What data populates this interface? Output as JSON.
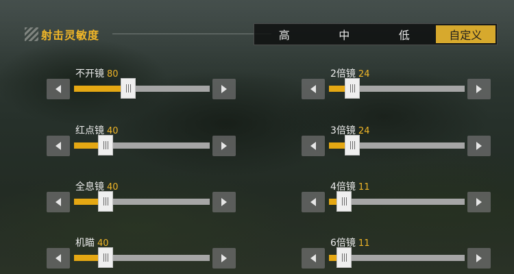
{
  "header": {
    "title": "射击灵敏度",
    "presets": [
      {
        "label": "高",
        "active": false
      },
      {
        "label": "中",
        "active": false
      },
      {
        "label": "低",
        "active": false
      },
      {
        "label": "自定义",
        "active": true
      }
    ]
  },
  "sliders": [
    {
      "label": "不开镜",
      "value": "80",
      "fill_fraction": 0.4
    },
    {
      "label": "2倍镜",
      "value": "24",
      "fill_fraction": 0.17
    },
    {
      "label": "红点镜",
      "value": "40",
      "fill_fraction": 0.23
    },
    {
      "label": "3倍镜",
      "value": "24",
      "fill_fraction": 0.17
    },
    {
      "label": "全息镜",
      "value": "40",
      "fill_fraction": 0.23
    },
    {
      "label": "4倍镜",
      "value": "11",
      "fill_fraction": 0.11
    },
    {
      "label": "机瞄",
      "value": "40",
      "fill_fraction": 0.23
    },
    {
      "label": "6倍镜",
      "value": "11",
      "fill_fraction": 0.11
    }
  ],
  "colors": {
    "accent": "#f0b628",
    "track": "#a6a6a6",
    "fill": "#e5a813"
  },
  "icons": {
    "left_arrow": "chevron-left-icon",
    "right_arrow": "chevron-right-icon",
    "title_decor": "stripes-icon"
  }
}
